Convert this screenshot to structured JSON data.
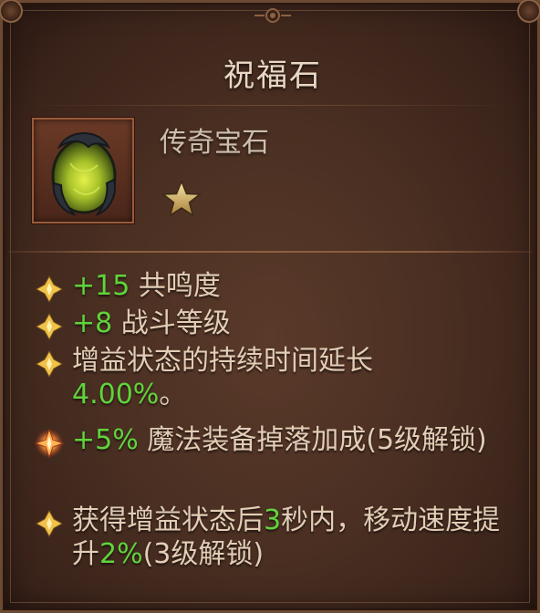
{
  "item": {
    "name": "祝福石",
    "rarity": "传奇宝石",
    "star_count": 1
  },
  "affixes": [
    {
      "value": "+15",
      "text": " 共鸣度",
      "bullet": "gold-diamond-icon"
    },
    {
      "value": "+8",
      "text": " 战斗等级",
      "bullet": "gold-diamond-icon"
    },
    {
      "prefix": "增益状态的持续时间延长",
      "value": "4.00%",
      "suffix": "。",
      "bullet": "gold-diamond-icon"
    },
    {
      "value": "+5%",
      "text": " 魔法装备掉落加成(5级解锁)",
      "bullet": "orange-burst-icon"
    },
    {
      "prefix": "获得增益状态后",
      "value": "3",
      "middle": "秒内，移动速度提升",
      "value2": "2%",
      "suffix": "(3级解锁)",
      "bullet": "gold-diamond-icon"
    }
  ],
  "colors": {
    "value_green": "#5fd43c",
    "text": "#e2cdb6",
    "title": "#e9d8c4",
    "background": "#4a2f22"
  }
}
